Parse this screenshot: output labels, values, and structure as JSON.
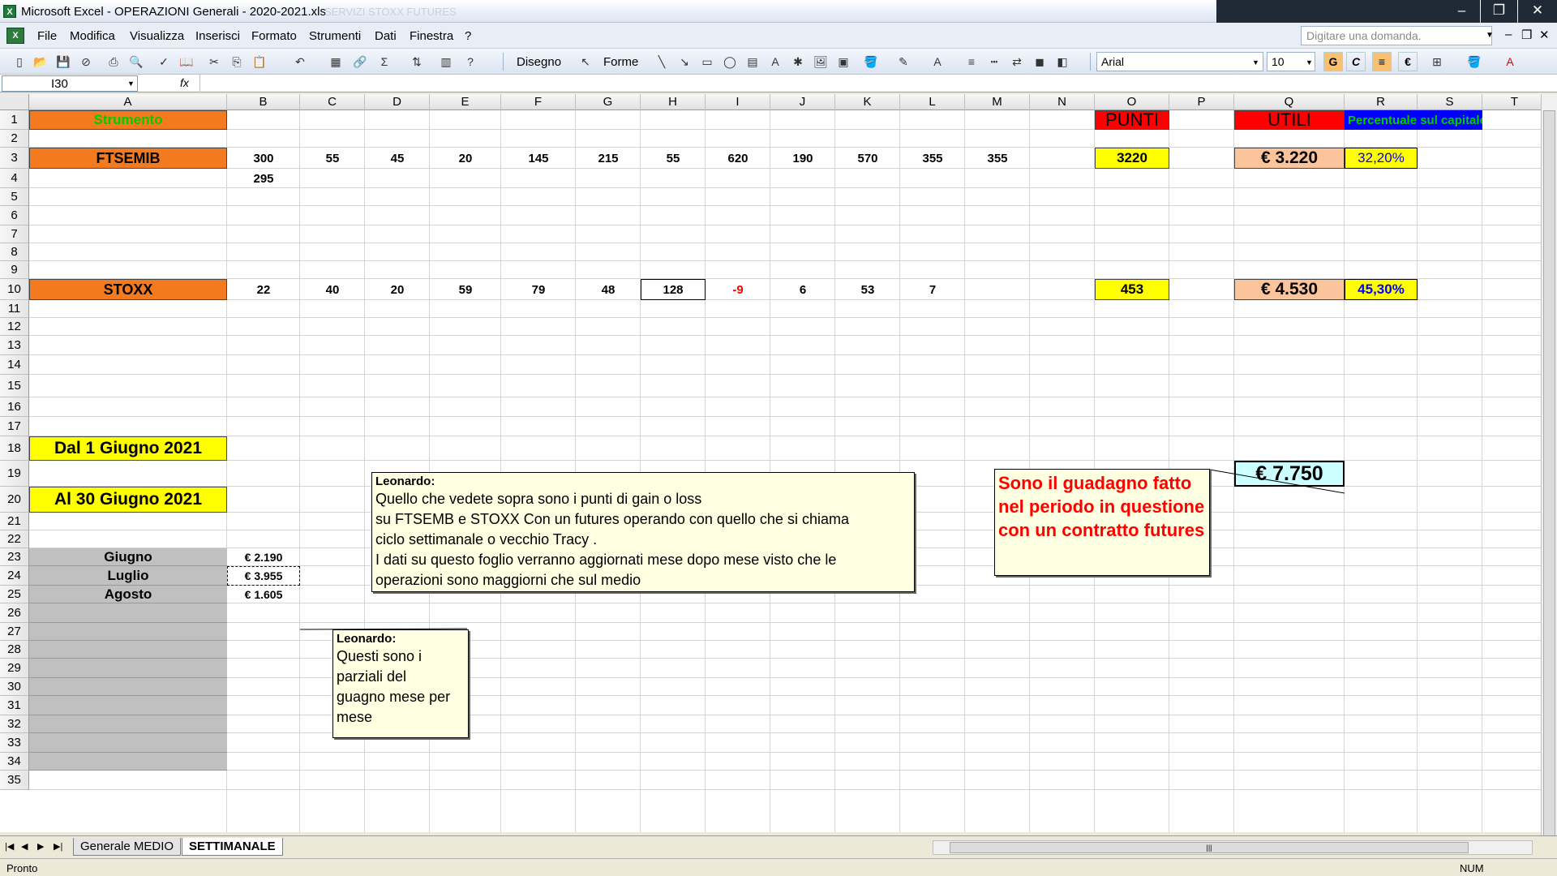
{
  "window": {
    "title": "Microsoft Excel - OPERAZIONI Generali - 2020-2021.xls",
    "ghost_text": "SERVIZI STOXX FUTURES",
    "min": "‒",
    "max": "❐",
    "close": "✕"
  },
  "menu": {
    "items": [
      "File",
      "Modifica",
      "Visualizza",
      "Inserisci",
      "Formato",
      "Strumenti",
      "Dati",
      "Finestra",
      "?"
    ],
    "help_placeholder": "Digitare una domanda."
  },
  "toolbar": {
    "disegno": "Disegno",
    "forme": "Forme",
    "font_name": "Arial",
    "font_size": "10",
    "bold": "G",
    "italic": "C",
    "euro": "€"
  },
  "formula_bar": {
    "cell_ref": "I30",
    "fx": "fx"
  },
  "grid": {
    "columns": [
      "A",
      "B",
      "C",
      "D",
      "E",
      "F",
      "G",
      "H",
      "I",
      "J",
      "K",
      "L",
      "M",
      "N",
      "O",
      "P",
      "Q",
      "R",
      "S",
      "T"
    ],
    "rows": [
      "1",
      "2",
      "3",
      "4",
      "5",
      "6",
      "7",
      "8",
      "9",
      "10",
      "11",
      "12",
      "13",
      "14",
      "15",
      "16",
      "17",
      "18",
      "19",
      "20",
      "21",
      "22",
      "23",
      "24",
      "25",
      "26",
      "27",
      "28",
      "29",
      "30",
      "31",
      "32",
      "33",
      "34",
      "35"
    ]
  },
  "cells": {
    "strumento": "Strumento",
    "punti": "PUNTI",
    "utili": "UTILI",
    "percentuale": "Percentuale sul capitale",
    "ftsemib": "FTSEMIB",
    "ftsemib_values": [
      "300",
      "55",
      "45",
      "20",
      "145",
      "215",
      "55",
      "620",
      "190",
      "570",
      "355",
      "355"
    ],
    "ftsemib_b4": "295",
    "ftsemib_punti": "3220",
    "ftsemib_utili": "€ 3.220",
    "ftsemib_perc": "32,20%",
    "stoxx": "STOXX",
    "stoxx_values": [
      "22",
      "40",
      "20",
      "59",
      "79",
      "48",
      "128",
      "-9",
      "6",
      "53",
      "7"
    ],
    "stoxx_punti": "453",
    "stoxx_utili": "€ 4.530",
    "stoxx_perc": "45,30%",
    "dal": "Dal 1 Giugno  2021",
    "al": "Al 30 Giugno 2021",
    "totale": "€ 7.750",
    "months": [
      {
        "name": "Giugno",
        "value": "€ 2.190"
      },
      {
        "name": "Luglio",
        "value": "€ 3.955"
      },
      {
        "name": "Agosto",
        "value": "€ 1.605"
      }
    ]
  },
  "comments": {
    "main_author": "Leonardo:",
    "main_lines": [
      "Quello che vedete sopra sono i punti di gain o loss",
      "su FTSEMB e STOXX Con un futures operando con quello che si chiama",
      "ciclo settimanale o vecchio Tracy .",
      "I dati su questo foglio verranno aggiornati mese dopo mese visto che le",
      "operazioni sono maggiorni che sul medio"
    ],
    "guadagno": "Sono il guadagno fatto nel periodo in questione con un contratto futures",
    "monthly_author": "Leonardo:",
    "monthly_lines": [
      "Questi sono i",
      "parziali del",
      "guagno mese per",
      "mese"
    ]
  },
  "sheets": {
    "tabs": [
      "Generale MEDIO",
      "SETTIMANALE"
    ],
    "active": "SETTIMANALE"
  },
  "status": {
    "left": "Pronto",
    "right": "NUM"
  },
  "colors": {
    "orange": "#f47a20",
    "green_text": "#00cc00",
    "red": "#ff0000",
    "blue": "#0000ff",
    "yellow": "#ffff00"
  }
}
